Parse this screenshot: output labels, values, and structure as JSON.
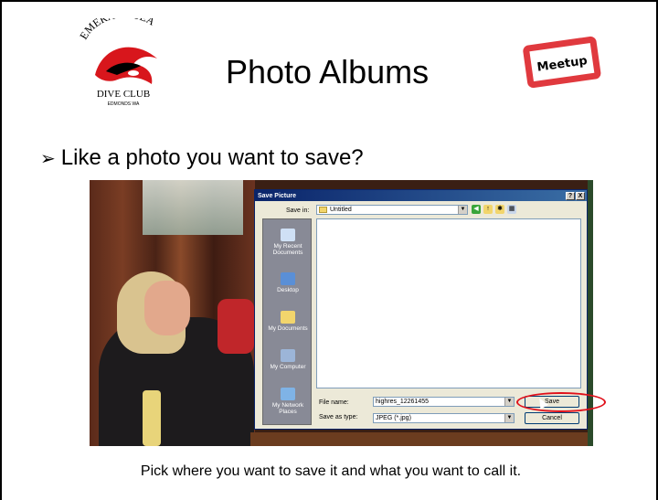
{
  "slide": {
    "title": "Photo Albums",
    "bullet": "Like a photo you want to save?",
    "caption": "Pick where you want to save it and what you want to call it."
  },
  "logos": {
    "club_arc": "EMERALD SEA",
    "club_name": "DIVE CLUB",
    "club_city": "EDMONDS WA",
    "meetup": "Meetup"
  },
  "dialog": {
    "title": "Save Picture",
    "title_buttons": [
      "?",
      "X"
    ],
    "save_in_label": "Save in:",
    "save_in_value": "Untitled",
    "toolbar_icons": [
      "back-icon",
      "up-folder-icon",
      "new-folder-icon",
      "view-menu-icon"
    ],
    "places": [
      {
        "label": "My Recent Documents",
        "icon": "recent-documents-icon"
      },
      {
        "label": "Desktop",
        "icon": "desktop-icon"
      },
      {
        "label": "My Documents",
        "icon": "my-documents-icon"
      },
      {
        "label": "My Computer",
        "icon": "my-computer-icon"
      },
      {
        "label": "My Network Places",
        "icon": "network-places-icon"
      }
    ],
    "file_name_label": "File name:",
    "file_name_value": "highres_12261455",
    "save_as_type_label": "Save as type:",
    "save_as_type_value": "JPEG (*.jpg)",
    "save_button": "Save",
    "cancel_button": "Cancel"
  },
  "colors": {
    "titlebar": "#0a246a",
    "highlight": "#e0101a",
    "dialog_bg": "#ece9d8"
  }
}
